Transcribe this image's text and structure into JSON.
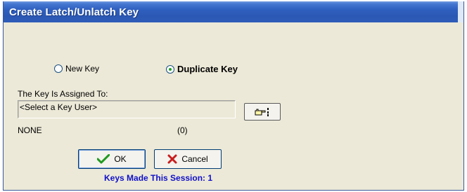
{
  "window": {
    "title": "Create Latch/Unlatch Key"
  },
  "key_type": {
    "new_key_label": "New Key",
    "duplicate_key_label": "Duplicate Key",
    "selected": "Duplicate Key"
  },
  "assignment": {
    "label": "The Key Is Assigned To:",
    "user_value": "<Select a Key User>",
    "select_user_icon": "pointing-hand-icon"
  },
  "status": {
    "user_name": "NONE",
    "count": "(0)"
  },
  "buttons": {
    "ok_label": "OK",
    "ok_icon": "checkmark-icon",
    "cancel_label": "Cancel",
    "cancel_icon": "x-icon"
  },
  "session": {
    "text": "Keys Made This Session: 1"
  },
  "colors": {
    "title_bar": "#2b58b3",
    "dialog_bg": "#ece9d8",
    "session_text": "#1010c8",
    "radio_dot": "#21a121",
    "ok_check": "#1f9a1f",
    "cancel_x": "#c81e1e"
  }
}
